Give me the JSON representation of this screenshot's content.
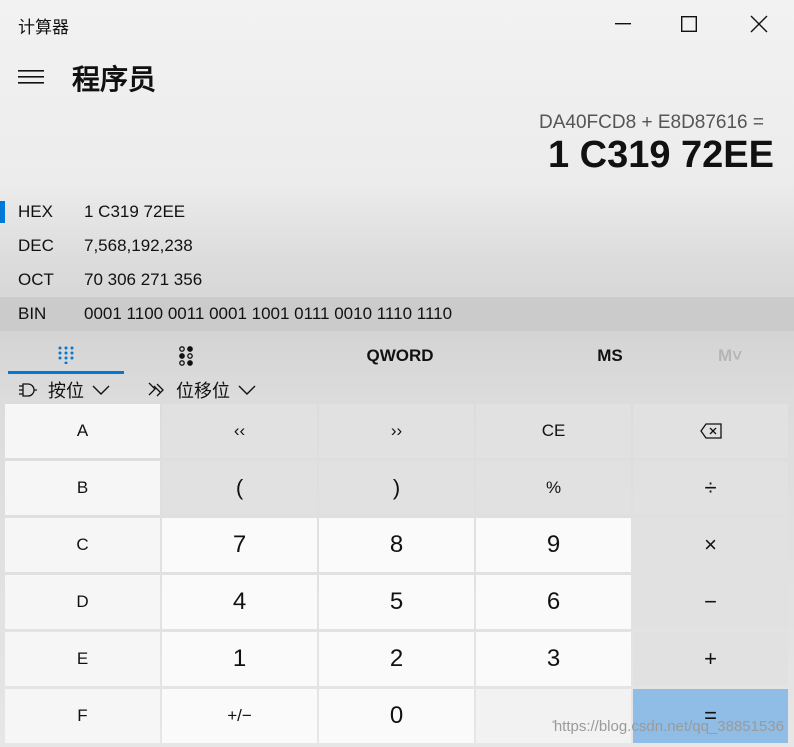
{
  "window": {
    "title": "计算器",
    "controls": {
      "minimize": "minimize-icon",
      "maximize": "maximize-icon",
      "close": "close-icon"
    }
  },
  "header": {
    "menu_icon": "hamburger-icon",
    "mode_title": "程序员"
  },
  "display": {
    "expression": "DA40FCD8 + E8D87616 =",
    "result": "1 C319 72EE"
  },
  "radix": [
    {
      "label": "HEX",
      "value": "1 C319 72EE",
      "selected": true
    },
    {
      "label": "DEC",
      "value": "7,568,192,238"
    },
    {
      "label": "OCT",
      "value": "70 306 271 356"
    },
    {
      "label": "BIN",
      "value": "0001 1100 0011 0001 1001 0111 0010 1110 1110"
    }
  ],
  "tabs": {
    "keypad_icon": "full-keypad-icon",
    "bits_icon": "bit-toggle-keypad-icon",
    "word_size": "QWORD",
    "memory_store": "MS",
    "memory_list": "M˅"
  },
  "operators": {
    "bitwise_label": "按位",
    "shift_label": "位移位"
  },
  "keys": {
    "row1": [
      "A",
      "‹‹",
      "››",
      "CE",
      "⌫"
    ],
    "row2": [
      "B",
      "(",
      ")",
      "%",
      "÷"
    ],
    "row3": [
      "C",
      "7",
      "8",
      "9",
      "×"
    ],
    "row4": [
      "D",
      "4",
      "5",
      "6",
      "−"
    ],
    "row5": [
      "E",
      "1",
      "2",
      "3",
      "+"
    ],
    "row6": [
      "F",
      "+/−",
      "0",
      ".",
      "="
    ]
  },
  "watermark": "https://blog.csdn.net/qq_38851536",
  "colors": {
    "accent": "#0078d7",
    "equals_bg": "#8fbde6"
  }
}
